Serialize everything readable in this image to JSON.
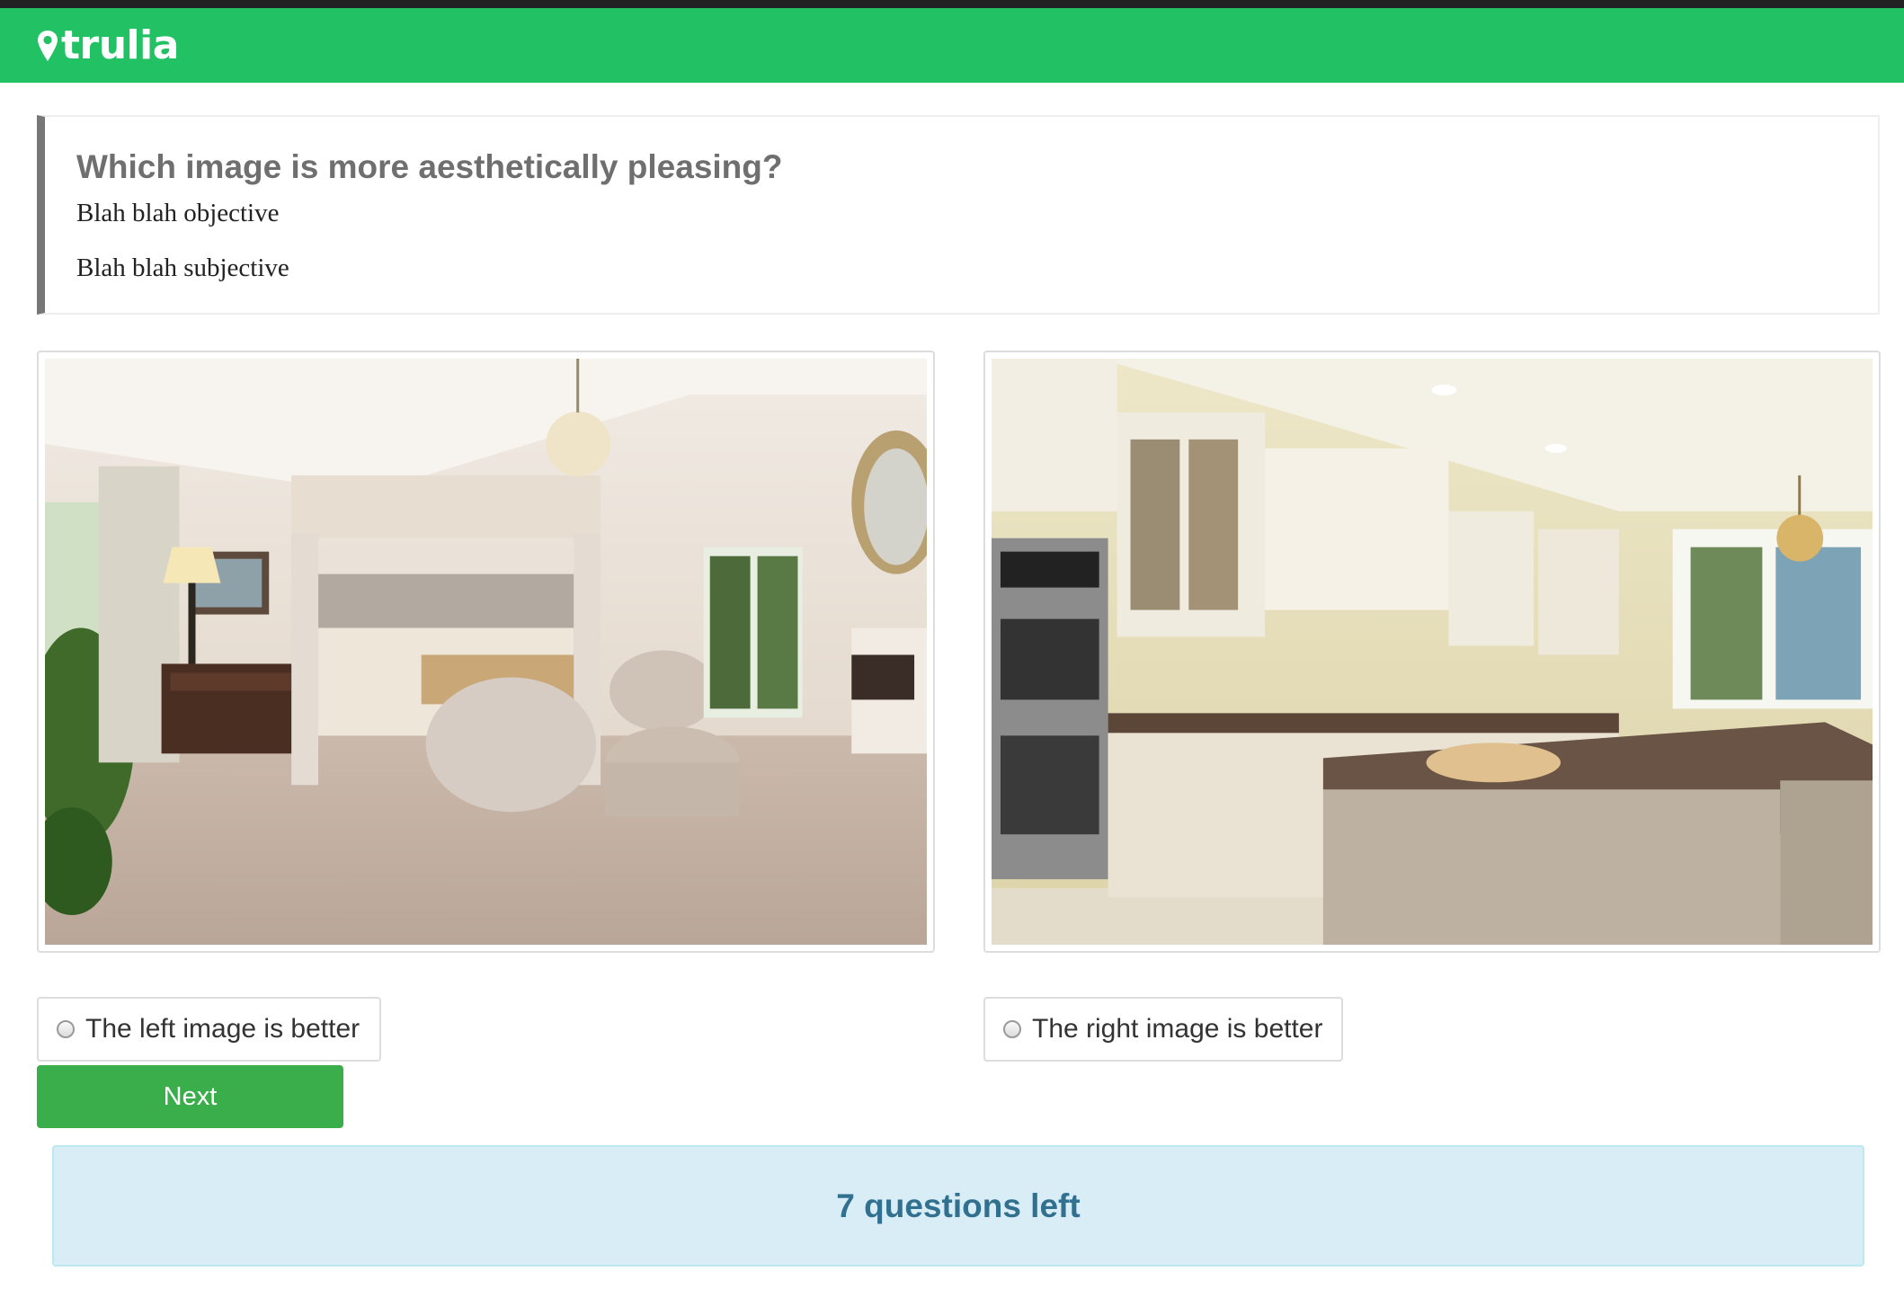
{
  "header": {
    "brand": "trulia",
    "brand_color": "#22c163",
    "logo_icon": "map-pin-icon"
  },
  "question": {
    "title": "Which image is more aesthetically pleasing?",
    "objective": "Blah blah objective",
    "subjective": "Blah blah subjective"
  },
  "images": {
    "left": "bedroom photo",
    "right": "kitchen photo"
  },
  "choices": {
    "left_label": "The left image is better",
    "right_label": "The right image is better",
    "left_selected": false,
    "right_selected": false
  },
  "next_button": {
    "label": "Next",
    "color": "#3aae4a"
  },
  "status": {
    "text": "7 questions left"
  }
}
